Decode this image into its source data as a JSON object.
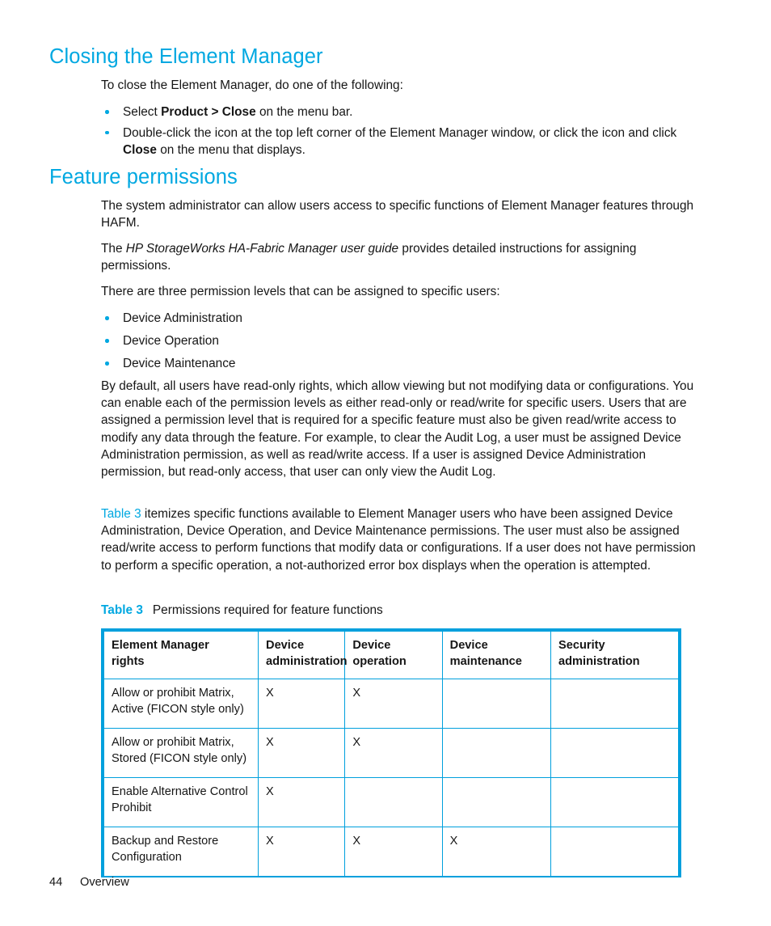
{
  "document": {
    "accent_color": "#00a8e1",
    "table_border_color": "#00a0dd",
    "text_color": "#161616"
  },
  "sections": [
    {
      "heading": "Closing the Element Manager",
      "intro": "To close the Element Manager, do one of the following:",
      "bullets": [
        {
          "part1": "Select ",
          "bold1": "Product > Close",
          "part2": " on the menu bar."
        },
        {
          "part1": "Double-click the icon at the top left corner of the Element Manager window, or click the icon and click ",
          "bold1": "Close",
          "part2": " on the menu that displays."
        }
      ]
    },
    {
      "heading": "Feature permissions",
      "paragraphs": {
        "p1": "The system administrator can allow users access to specific functions of Element Manager features through HAFM.",
        "p2_prefix": "The ",
        "p2_italic": "HP StorageWorks HA-Fabric Manager user guide",
        "p2_suffix": " provides detailed instructions for assigning permissions.",
        "p3": "There are three permission levels that can be assigned to specific users:",
        "p4": "By default, all users have read-only rights, which allow viewing but not modifying data or configurations. You can enable each of the permission levels as either read-only or read/write for specific users. Users that are assigned a permission level that is required for a specific feature must also be given read/write access to modify any data through the feature. For example, to clear the Audit Log, a user must be assigned Device Administration permission, as well as read/write access. If a user is assigned Device Administration permission, but read-only access, that user can only view the Audit Log.",
        "p5_xref": "Table 3",
        "p5_rest": " itemizes specific functions available to Element Manager users who have been assigned Device Administration, Device Operation, and Device Maintenance permissions. The user must also be assigned read/write access to perform functions that modify data or configurations. If a user does not have permission to perform a specific operation, a not-authorized error box displays when the operation is attempted."
      },
      "permission_levels": [
        "Device Administration",
        "Device Operation",
        "Device Maintenance"
      ]
    }
  ],
  "table": {
    "caption_label": "Table 3",
    "caption_text": "Permissions required for feature functions",
    "headers": [
      {
        "line1": "Element Manager",
        "line2": "rights"
      },
      {
        "line1": "Device",
        "line2": "administration"
      },
      {
        "line1": "Device",
        "line2": "operation"
      },
      {
        "line1": "Device",
        "line2": "maintenance"
      },
      {
        "line1": "Security",
        "line2": "administration"
      }
    ],
    "rows": [
      {
        "label_line1": "Allow or prohibit Matrix,",
        "label_line2": "Active (FICON style only)",
        "device_administration": "X",
        "device_operation": "X",
        "device_maintenance": "",
        "security_administration": ""
      },
      {
        "label_line1": "Allow or prohibit Matrix,",
        "label_line2": "Stored (FICON style only)",
        "device_administration": "X",
        "device_operation": "X",
        "device_maintenance": "",
        "security_administration": ""
      },
      {
        "label_line1": "Enable Alternative Control",
        "label_line2": "Prohibit",
        "device_administration": "X",
        "device_operation": "",
        "device_maintenance": "",
        "security_administration": ""
      },
      {
        "label_line1": "Backup and Restore",
        "label_line2": "Configuration",
        "device_administration": "X",
        "device_operation": "X",
        "device_maintenance": "X",
        "security_administration": ""
      }
    ]
  },
  "footer": {
    "page_number": "44",
    "chapter": "Overview"
  }
}
